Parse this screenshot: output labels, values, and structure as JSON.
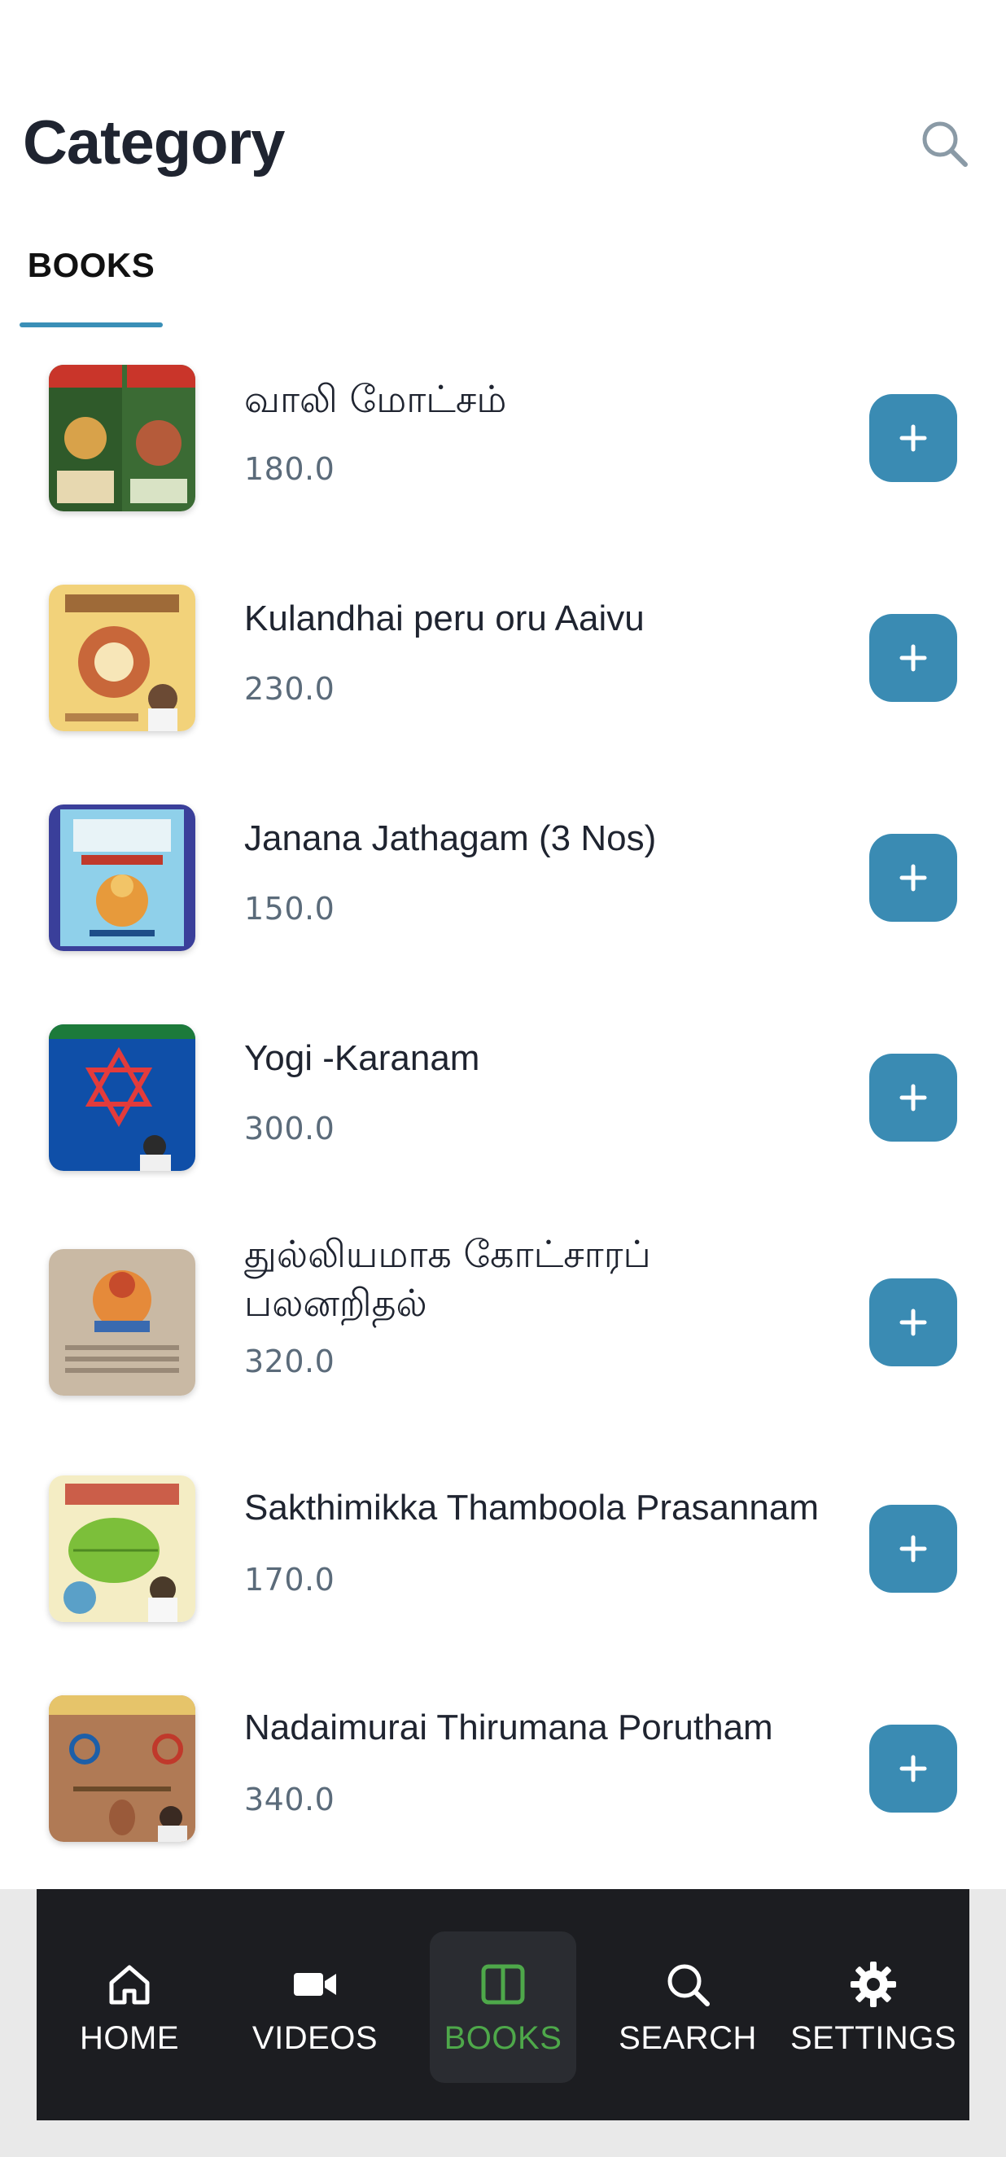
{
  "header": {
    "title": "Category",
    "search_icon": "search-icon"
  },
  "tabs": [
    {
      "label": "BOOKS",
      "active": true
    }
  ],
  "books": [
    {
      "name": "வாலி மோட்சம்",
      "price": "180.0",
      "cover": "book-cover-vaali-motcham"
    },
    {
      "name": "Kulandhai peru oru Aaivu",
      "price": "230.0",
      "cover": "book-cover-kulandhai-peru"
    },
    {
      "name": "Janana Jathagam (3 Nos)",
      "price": "150.0",
      "cover": "book-cover-janana-jathagam"
    },
    {
      "name": "Yogi -Karanam",
      "price": "300.0",
      "cover": "book-cover-yogi-karanam"
    },
    {
      "name": "துல்லியமாக கோட்சாரப் பலனறிதல்",
      "price": "320.0",
      "cover": "book-cover-kotchara-palan"
    },
    {
      "name": "Sakthimikka Thamboola Prasannam",
      "price": "170.0",
      "cover": "book-cover-thamboola-prasannam"
    },
    {
      "name": "Nadaimurai Thirumana Porutham",
      "price": "340.0",
      "cover": "book-cover-thirumana-porutham"
    }
  ],
  "add_icon": "plus-icon",
  "nav": [
    {
      "label": "HOME",
      "icon": "home-icon"
    },
    {
      "label": "VIDEOS",
      "icon": "video-camera-icon"
    },
    {
      "label": "BOOKS",
      "icon": "book-icon",
      "active": true
    },
    {
      "label": "SEARCH",
      "icon": "search-icon"
    },
    {
      "label": "SETTINGS",
      "icon": "gear-icon"
    }
  ],
  "colors": {
    "accent": "#3a8bb3",
    "nav_background": "#1c1d21",
    "nav_active": "#4ea84a",
    "price_text": "#5b6b7a"
  }
}
